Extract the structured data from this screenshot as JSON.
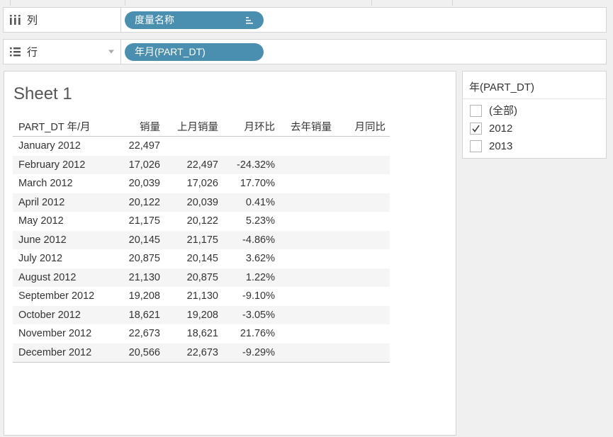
{
  "shelves": {
    "columns": {
      "label": "列",
      "icon": "columns-icon",
      "pill": "度量名称",
      "pill_icon": "sort-icon"
    },
    "rows": {
      "label": "行",
      "icon": "rows-list-icon",
      "pill": "年月(PART_DT)"
    }
  },
  "sheet": {
    "title": "Sheet 1",
    "headers": [
      "PART_DT 年/月",
      "销量",
      "上月销量",
      "月环比",
      "去年销量",
      "月同比"
    ],
    "rows": [
      [
        "January 2012",
        "22,497",
        "",
        "",
        "",
        ""
      ],
      [
        "February 2012",
        "17,026",
        "22,497",
        "-24.32%",
        "",
        ""
      ],
      [
        "March 2012",
        "20,039",
        "17,026",
        "17.70%",
        "",
        ""
      ],
      [
        "April 2012",
        "20,122",
        "20,039",
        "0.41%",
        "",
        ""
      ],
      [
        "May 2012",
        "21,175",
        "20,122",
        "5.23%",
        "",
        ""
      ],
      [
        "June 2012",
        "20,145",
        "21,175",
        "-4.86%",
        "",
        ""
      ],
      [
        "July 2012",
        "20,875",
        "20,145",
        "3.62%",
        "",
        ""
      ],
      [
        "August 2012",
        "21,130",
        "20,875",
        "1.22%",
        "",
        ""
      ],
      [
        "September 2012",
        "19,208",
        "21,130",
        "-9.10%",
        "",
        ""
      ],
      [
        "October 2012",
        "18,621",
        "19,208",
        "-3.05%",
        "",
        ""
      ],
      [
        "November 2012",
        "22,673",
        "18,621",
        "21.76%",
        "",
        ""
      ],
      [
        "December 2012",
        "20,566",
        "22,673",
        "-9.29%",
        "",
        ""
      ]
    ]
  },
  "filter": {
    "title": "年(PART_DT)",
    "options": [
      {
        "label": "(全部)",
        "checked": false
      },
      {
        "label": "2012",
        "checked": true
      },
      {
        "label": "2013",
        "checked": false
      }
    ]
  },
  "colors": {
    "pill": "#4a8fb0",
    "row_alt": "#f5f5f5",
    "border": "#d4d4d4"
  }
}
